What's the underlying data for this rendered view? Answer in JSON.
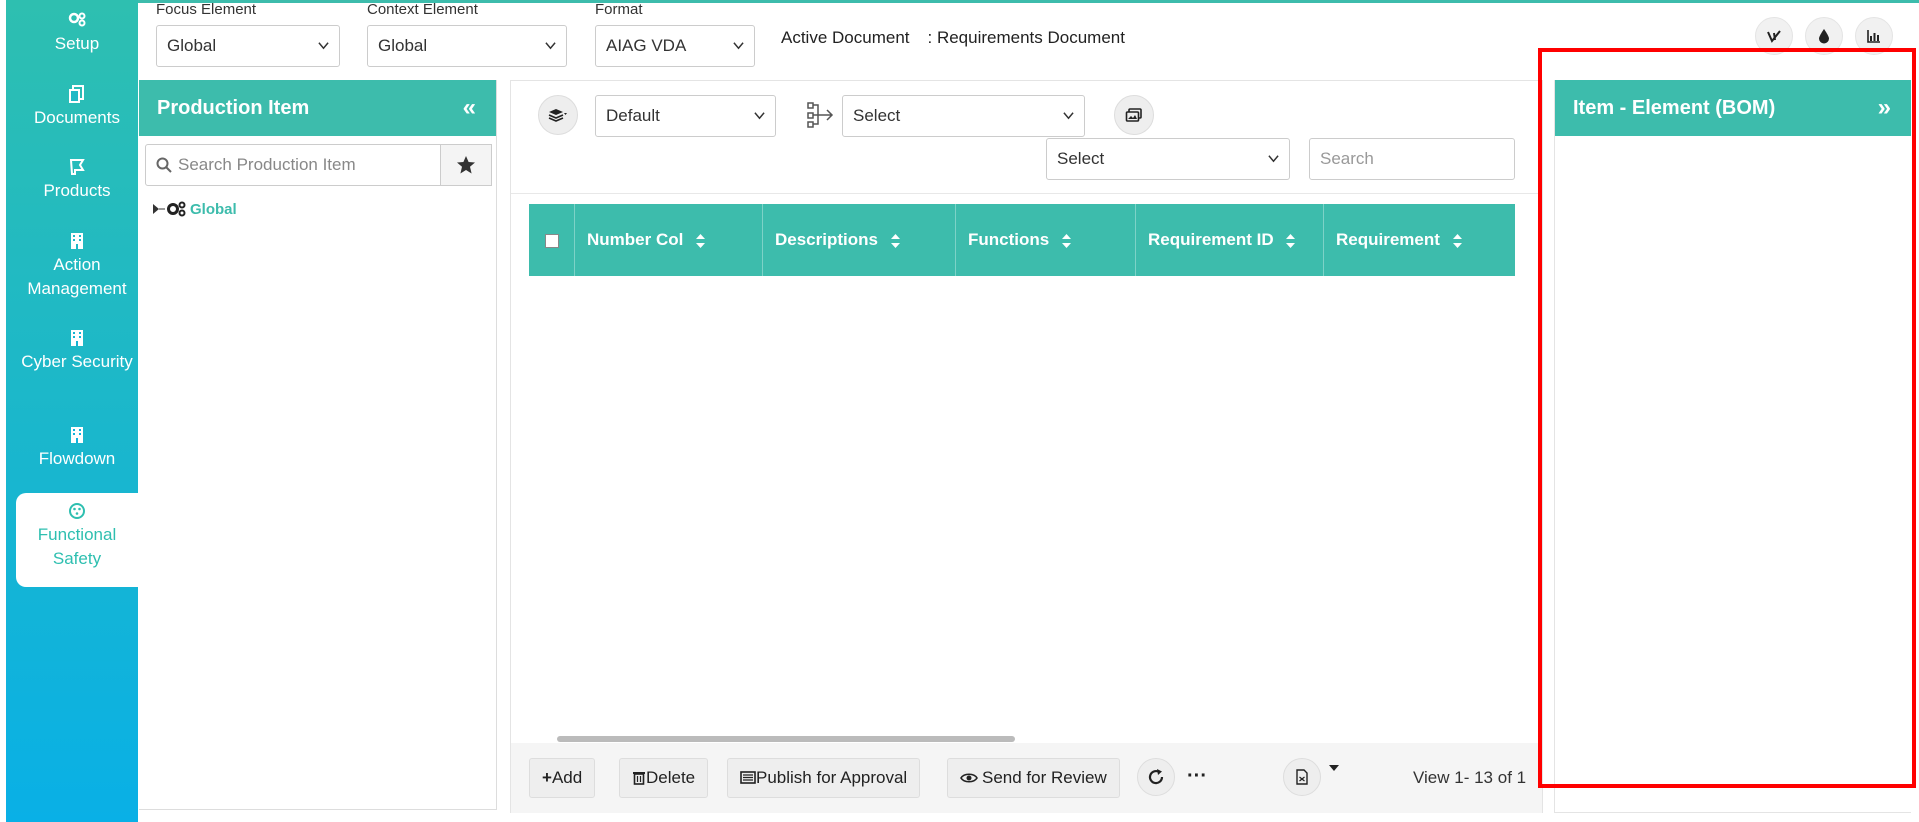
{
  "sidebar": {
    "items": [
      {
        "label": "Setup",
        "icon": "gears-icon"
      },
      {
        "label": "Documents",
        "icon": "documents-icon"
      },
      {
        "label": "Products",
        "icon": "products-icon"
      },
      {
        "label": "Action Management",
        "icon": "building-icon"
      },
      {
        "label": "Cyber Security",
        "icon": "building-icon"
      },
      {
        "label": "Flowdown",
        "icon": "building-icon"
      },
      {
        "label": "Functional Safety",
        "icon": "safety-icon",
        "active": true
      }
    ]
  },
  "topbar": {
    "focus_label": "Focus Element",
    "focus_value": "Global",
    "context_label": "Context Element",
    "context_value": "Global",
    "format_label": "Format",
    "format_value": "AIAG VDA",
    "active_doc_label": "Active Document",
    "active_doc_value": ": Requirements Document"
  },
  "production_panel": {
    "title": "Production Item",
    "search_placeholder": "Search Production Item",
    "tree_root": "Global"
  },
  "center": {
    "view_select": "Default",
    "flow_select": "Select",
    "filter_select": "Select",
    "search_placeholder": "Search",
    "columns": [
      "Number Col",
      "Descriptions",
      "Functions",
      "Requirement ID",
      "Requirement"
    ],
    "buttons": {
      "add": "Add",
      "delete": "Delete",
      "publish": "Publish for Approval",
      "review": "Send for Review"
    },
    "page_info": "View 1- 13 of 1"
  },
  "right_panel": {
    "title": "Item - Element (BOM)"
  },
  "colors": {
    "accent": "#3dbcac",
    "highlight": "#ff0000"
  }
}
